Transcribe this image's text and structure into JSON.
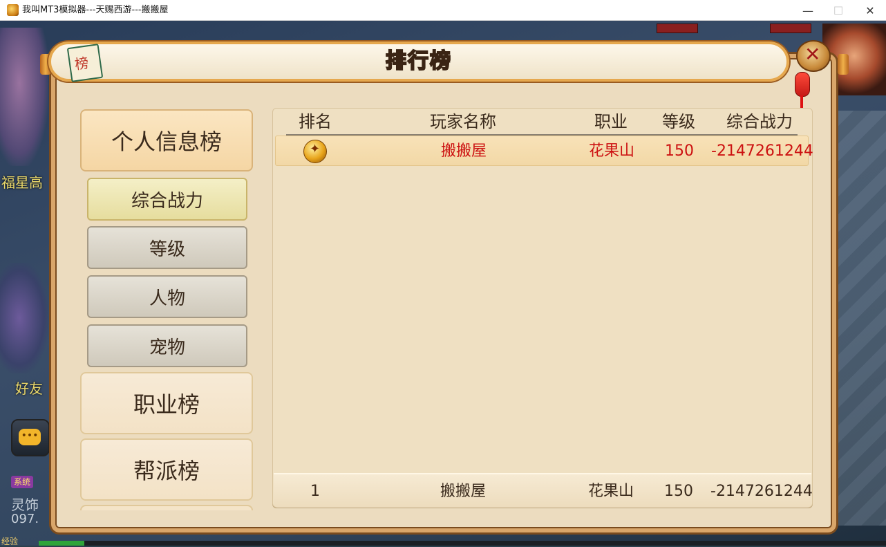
{
  "window": {
    "title": "我叫MT3模拟器---天赐西游---搬搬屋",
    "min_glyph": "—",
    "max_glyph": "☐",
    "close_glyph": "✕"
  },
  "game_bg": {
    "side_text_1": "福星高",
    "side_text_2": "好友",
    "chat_glyph": "•••",
    "system_badge": "系统",
    "chat_line_1": "灵饰",
    "chat_line_2": "097.",
    "exp_label": "经验"
  },
  "dialog": {
    "title": "排行榜",
    "badge_char": "榜",
    "close_glyph": "✕"
  },
  "menu": {
    "personal": "个人信息榜",
    "sub": [
      "综合战力",
      "等级",
      "人物",
      "宠物"
    ],
    "career": "职业榜",
    "guild": "帮派榜"
  },
  "table": {
    "headers": [
      "排名",
      "玩家名称",
      "职业",
      "等级",
      "综合战力"
    ],
    "rows": [
      {
        "rank_icon": "gold-medal-icon",
        "name": "搬搬屋",
        "career": "花果山",
        "level": "150",
        "power": "-2147261244"
      }
    ],
    "self": {
      "rank": "1",
      "name": "搬搬屋",
      "career": "花果山",
      "level": "150",
      "power": "-2147261244"
    }
  },
  "colors": {
    "accent_red": "#cc1111",
    "dialog_bg": "#ecdcbf",
    "border_gold": "#d9a66a"
  }
}
